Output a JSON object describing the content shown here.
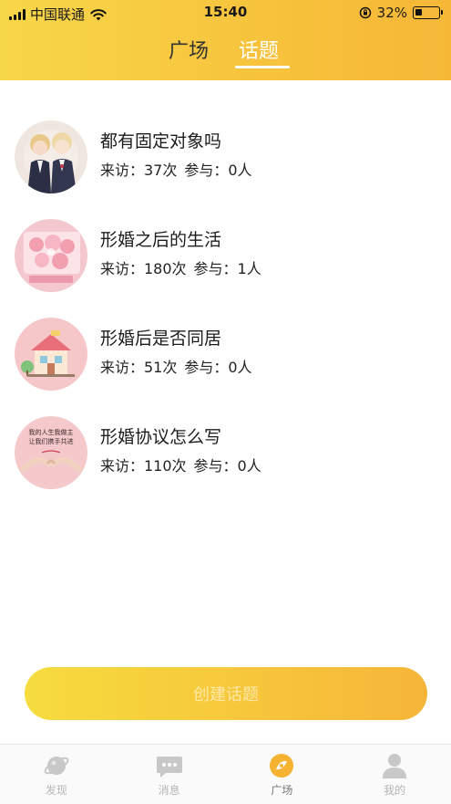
{
  "status_bar": {
    "carrier": "中国联通",
    "time": "15:40",
    "battery_percent": "32%",
    "battery_level": 0.32
  },
  "header": {
    "tabs": [
      {
        "label": "广场",
        "active": false
      },
      {
        "label": "话题",
        "active": true
      }
    ]
  },
  "topics": [
    {
      "title": "都有固定对象吗",
      "visits": "来访：37次",
      "participants": "参与：0人"
    },
    {
      "title": "形婚之后的生活",
      "visits": "来访：180次",
      "participants": "参与：1人"
    },
    {
      "title": "形婚后是否同居",
      "visits": "来访：51次",
      "participants": "参与：0人"
    },
    {
      "title": "形婚协议怎么写",
      "visits": "来访：110次",
      "participants": "参与：0人",
      "avatar_text": [
        "我的人生我做主",
        "让我们携手共进"
      ]
    }
  ],
  "create_button": {
    "label": "创建话题"
  },
  "tab_bar": {
    "items": [
      {
        "label": "发现",
        "icon": "planet-icon",
        "active": false
      },
      {
        "label": "消息",
        "icon": "chat-icon",
        "active": false
      },
      {
        "label": "广场",
        "icon": "plaza-icon",
        "active": true
      },
      {
        "label": "我的",
        "icon": "person-icon",
        "active": false
      }
    ]
  },
  "colors": {
    "accent_yellow": "#f7c23c",
    "accent_orange": "#f6b539",
    "active_tab_icon": "#f5b331",
    "inactive_tab_icon": "#c8c8c8"
  }
}
